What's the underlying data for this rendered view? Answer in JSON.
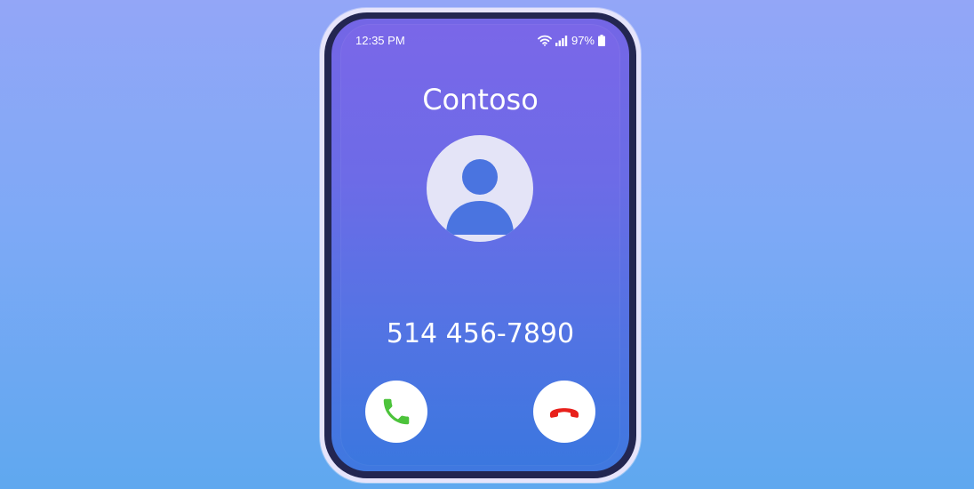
{
  "status_bar": {
    "time": "12:35 PM",
    "battery": "97%",
    "icons": [
      "wifi-icon",
      "signal-icon",
      "battery-icon"
    ]
  },
  "call": {
    "caller_name": "Contoso",
    "phone_number": "514 456-7890",
    "avatar_icon": "person-icon"
  },
  "actions": {
    "accept": {
      "icon": "phone-icon",
      "color": "#4cc33b"
    },
    "decline": {
      "icon": "hang-up-icon",
      "color": "#e8201b"
    }
  },
  "colors": {
    "background_top": "#93a6f7",
    "background_bottom": "#5fa8ef",
    "phone_frame": "#232651",
    "screen_top": "#7a67e8",
    "screen_bottom": "#3b77df",
    "avatar_bg": "#e4e4f7",
    "avatar_figure": "#4a74e0"
  }
}
